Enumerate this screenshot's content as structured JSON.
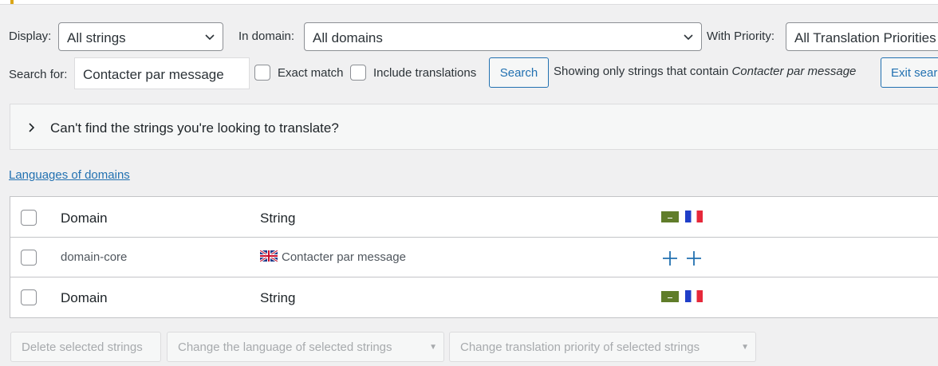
{
  "filters": {
    "display_label": "Display:",
    "display_value": "All strings",
    "domain_label": "In domain:",
    "domain_value": "All domains",
    "priority_label": "With Priority:",
    "priority_value": "All Translation Priorities"
  },
  "search": {
    "label": "Search for:",
    "value": "Contacter par message",
    "exact_match_label": "Exact match",
    "include_translations_label": "Include translations",
    "button_label": "Search",
    "showing_prefix": "Showing only strings that contain",
    "showing_term": "Contacter par message",
    "exit_label": "Exit search"
  },
  "help_panel": {
    "text": "Can't find the strings you're looking to translate?"
  },
  "languages_link": "Languages of domains",
  "table": {
    "header": {
      "domain": "Domain",
      "string": "String"
    },
    "rows": [
      {
        "domain": "domain-core",
        "string": "Contacter par message"
      }
    ],
    "footer": {
      "domain": "Domain",
      "string": "String"
    },
    "language_flags": [
      "ar",
      "fr"
    ]
  },
  "bulk_actions": {
    "delete": "Delete selected strings",
    "change_language": "Change the language of selected strings",
    "change_priority": "Change translation priority of selected strings"
  },
  "colors": {
    "accent": "#2271b1",
    "top_accent": "#dba617"
  }
}
